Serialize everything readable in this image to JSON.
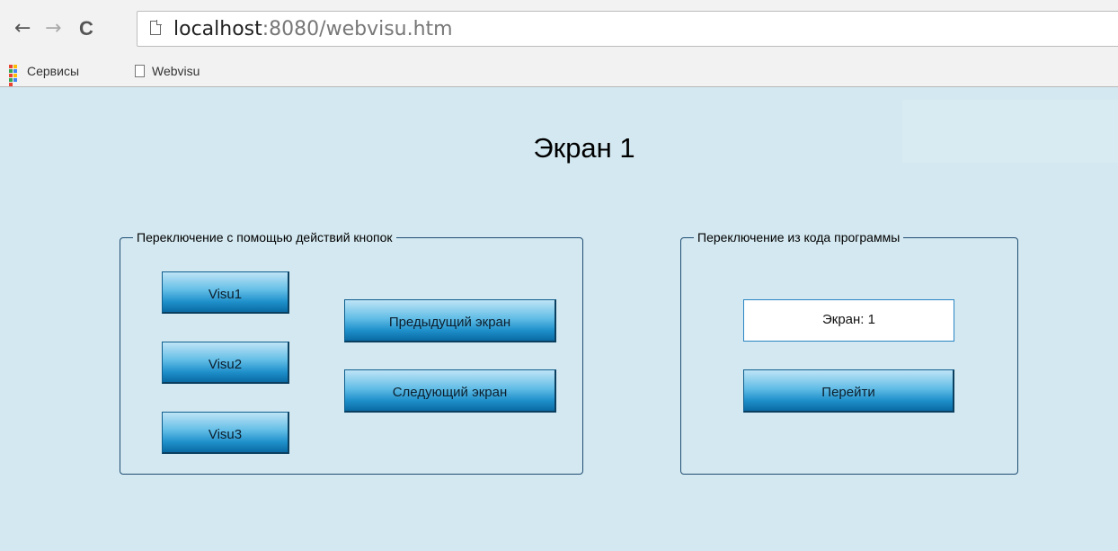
{
  "browser": {
    "nav": {
      "back": "←",
      "forward": "→",
      "reload": "C"
    },
    "url": {
      "host": "localhost",
      "path": ":8080/webvisu.htm"
    },
    "bookmarks": [
      {
        "label": "Сервисы",
        "icon": "apps-grid-icon"
      },
      {
        "label": "Webvisu",
        "icon": "page-icon"
      }
    ]
  },
  "visu": {
    "title": "Экран 1",
    "button_actions_group": {
      "legend": "Переключение с помощью действий кнопок",
      "visu1_label": "Visu1",
      "visu2_label": "Visu2",
      "visu3_label": "Visu3",
      "prev_label": "Предыдущий экран",
      "next_label": "Следующий экран"
    },
    "program_code_group": {
      "legend": "Переключение из кода программы",
      "screen_value": "Экран: 1",
      "go_label": "Перейти"
    },
    "colors": {
      "background": "#d3e8f0",
      "frame": "#1f4d73",
      "button_top": "#bfe4f6",
      "button_bottom": "#0a6aa3"
    }
  }
}
